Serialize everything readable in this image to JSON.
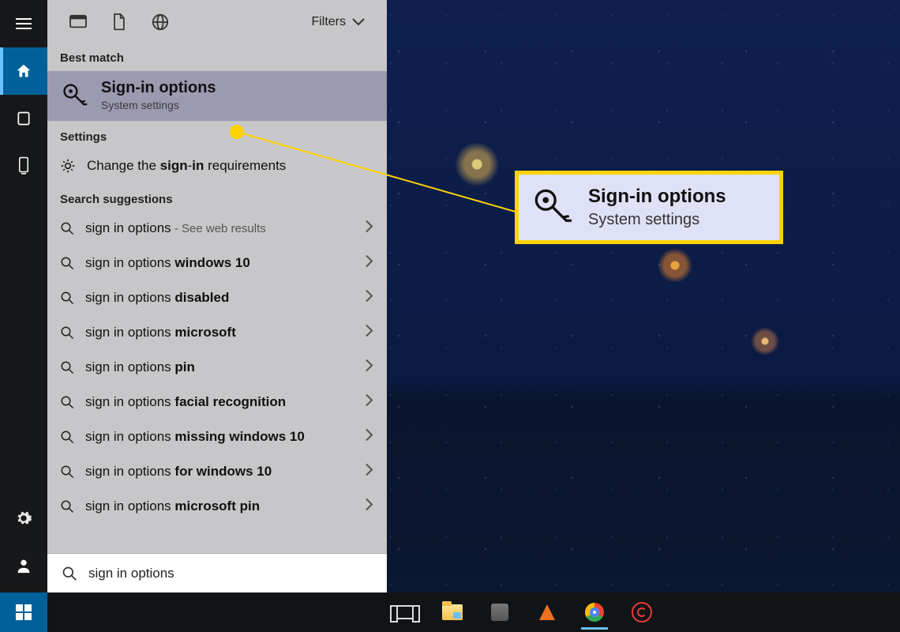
{
  "filters_label": "Filters",
  "sections": {
    "best_match": "Best match",
    "settings": "Settings",
    "suggestions": "Search suggestions"
  },
  "best_match": {
    "title": "Sign-in options",
    "subtitle": "System settings"
  },
  "settings_result": {
    "prefix": "Change the ",
    "bold1": "sign",
    "dash": "-",
    "bold2": "in",
    "suffix": " requirements"
  },
  "web_first": {
    "text": "sign in options",
    "note": " - See web results"
  },
  "suggestions": [
    {
      "prefix": "sign in options ",
      "bold": "windows 10"
    },
    {
      "prefix": "sign in options ",
      "bold": "disabled"
    },
    {
      "prefix": "sign in options ",
      "bold": "microsoft"
    },
    {
      "prefix": "sign in options ",
      "bold": "pin"
    },
    {
      "prefix": "sign in options ",
      "bold": "facial recognition"
    },
    {
      "prefix": "sign in options ",
      "bold": "missing windows 10"
    },
    {
      "prefix": "sign in options ",
      "bold": "for windows 10"
    },
    {
      "prefix": "sign in options ",
      "bold": "microsoft pin"
    }
  ],
  "search_query": "sign in options",
  "callout": {
    "title": "Sign-in options",
    "subtitle": "System settings"
  }
}
